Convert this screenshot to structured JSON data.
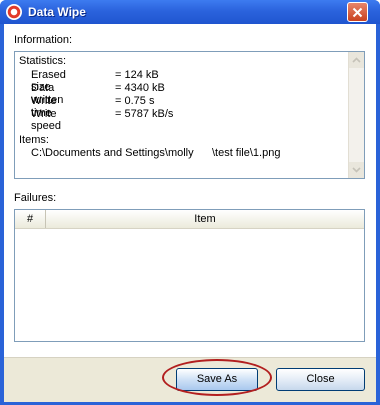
{
  "window": {
    "title": "Data Wipe",
    "icon": "lifebuoy-icon",
    "close_icon": "close-icon"
  },
  "information": {
    "label": "Information:",
    "statistics_heading": "Statistics:",
    "stats": [
      {
        "name": "Erased size",
        "value": "= 124 kB"
      },
      {
        "name": "Data written",
        "value": "= 4340 kB"
      },
      {
        "name": "Write time",
        "value": "= 0.75 s"
      },
      {
        "name": "Write speed",
        "value": "= 5787 kB/s"
      }
    ],
    "items_heading": "Items:",
    "items": [
      "C:\\Documents and Settings\\molly      \\test file\\1.png"
    ]
  },
  "failures": {
    "label": "Failures:",
    "columns": [
      "#",
      "Item"
    ]
  },
  "buttons": {
    "save_as": "Save As",
    "close": "Close"
  },
  "colors": {
    "titlebar": "#2b63dd",
    "highlight": "#b21f1f"
  }
}
